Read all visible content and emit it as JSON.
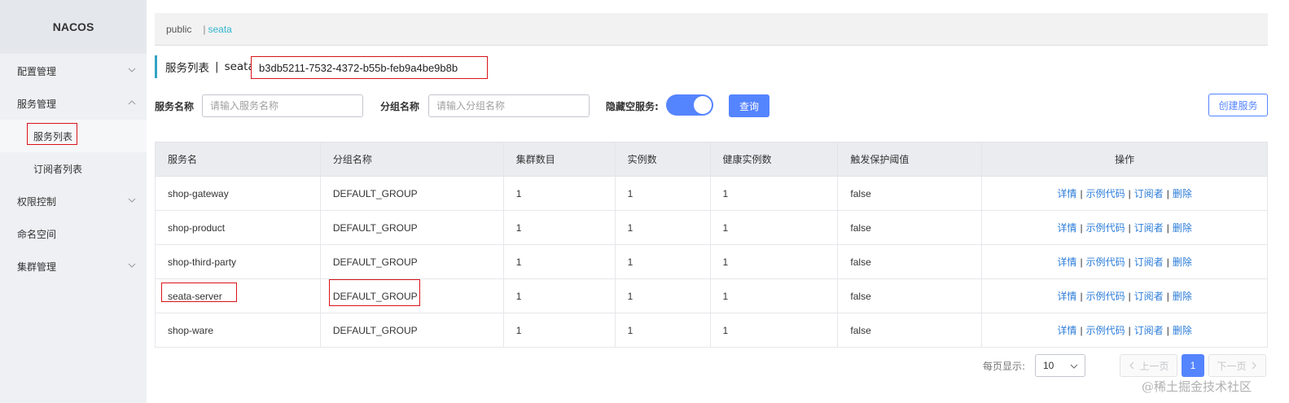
{
  "app": {
    "logo": "NACOS"
  },
  "sidebar": {
    "items": [
      {
        "label": "配置管理",
        "icon": "chevron-down-icon"
      },
      {
        "label": "服务管理",
        "icon": "chevron-up-icon",
        "children": [
          {
            "label": "服务列表"
          },
          {
            "label": "订阅者列表"
          }
        ]
      },
      {
        "label": "权限控制",
        "icon": "chevron-down-icon"
      },
      {
        "label": "命名空间"
      },
      {
        "label": "集群管理",
        "icon": "chevron-down-icon"
      }
    ]
  },
  "namespaces": {
    "items": [
      "public",
      "seata"
    ],
    "separator": "|"
  },
  "header": {
    "title": "服务列表",
    "separator": "|",
    "namespace_label": "seata",
    "namespace_id": "b3db5211-7532-4372-b55b-feb9a4be9b8b"
  },
  "search": {
    "service_label": "服务名称",
    "service_placeholder": "请输入服务名称",
    "group_label": "分组名称",
    "group_placeholder": "请输入分组名称",
    "hide_empty_label": "隐藏空服务:",
    "hide_empty_on": true,
    "query_button": "查询",
    "create_button": "创建服务"
  },
  "table": {
    "columns": [
      "服务名",
      "分组名称",
      "集群数目",
      "实例数",
      "健康实例数",
      "触发保护阈值",
      "操作"
    ],
    "rows": [
      {
        "name": "shop-gateway",
        "group": "DEFAULT_GROUP",
        "clusters": "1",
        "instances": "1",
        "healthy": "1",
        "threshold": "false"
      },
      {
        "name": "shop-product",
        "group": "DEFAULT_GROUP",
        "clusters": "1",
        "instances": "1",
        "healthy": "1",
        "threshold": "false"
      },
      {
        "name": "shop-third-party",
        "group": "DEFAULT_GROUP",
        "clusters": "1",
        "instances": "1",
        "healthy": "1",
        "threshold": "false"
      },
      {
        "name": "seata-server",
        "group": "DEFAULT_GROUP",
        "clusters": "1",
        "instances": "1",
        "healthy": "1",
        "threshold": "false"
      },
      {
        "name": "shop-ware",
        "group": "DEFAULT_GROUP",
        "clusters": "1",
        "instances": "1",
        "healthy": "1",
        "threshold": "false"
      }
    ],
    "actions": [
      "详情",
      "示例代码",
      "订阅者",
      "删除"
    ],
    "action_separator": "|"
  },
  "pagination": {
    "per_page_label": "每页显示:",
    "page_size": "10",
    "prev": "上一页",
    "current_page": "1",
    "next": "下一页"
  },
  "watermark": "@稀土掘金技术社区",
  "colors": {
    "primary": "#5584ff",
    "link": "#2b7cd9",
    "accent": "#33b5cf",
    "highlight": "#d9131b",
    "sidebar_bg": "#eef0f3"
  }
}
